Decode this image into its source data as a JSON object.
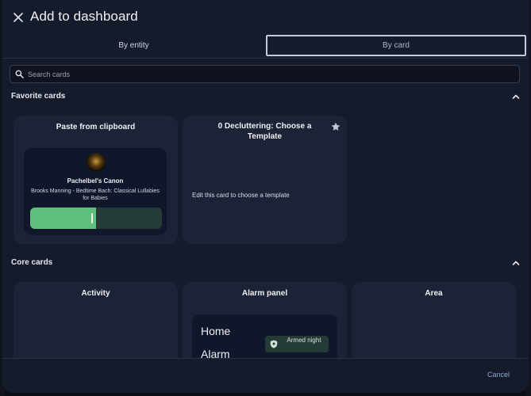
{
  "dialog": {
    "title": "Add to dashboard"
  },
  "tabs": [
    {
      "label": "By entity",
      "active": false
    },
    {
      "label": "By card",
      "active": true
    }
  ],
  "search": {
    "placeholder": "Search cards",
    "value": ""
  },
  "favorites": {
    "title": "Favorite cards",
    "cards": [
      {
        "title": "Paste from clipboard",
        "media": {
          "track": "Pachelbel's Canon",
          "subtitle": "Brooks Manning - Bedtime Bach: Classical Lullabies for Babies",
          "progress": 0.5
        }
      },
      {
        "title": "0 Decluttering: Choose a Template",
        "starred": true,
        "body": "Edit this card to choose a template"
      }
    ]
  },
  "core": {
    "title": "Core cards",
    "cards": [
      {
        "title": "Activity"
      },
      {
        "title": "Alarm panel",
        "preview": {
          "line1": "Home",
          "line2": "Alarm",
          "badge": "Armed night"
        }
      },
      {
        "title": "Area"
      }
    ]
  },
  "footer": {
    "cancel_label": "Cancel"
  },
  "colors": {
    "accent": "#5fbf7c",
    "link": "#8fa6d8",
    "surface": "#1d2336",
    "dialog": "#161b2b"
  }
}
